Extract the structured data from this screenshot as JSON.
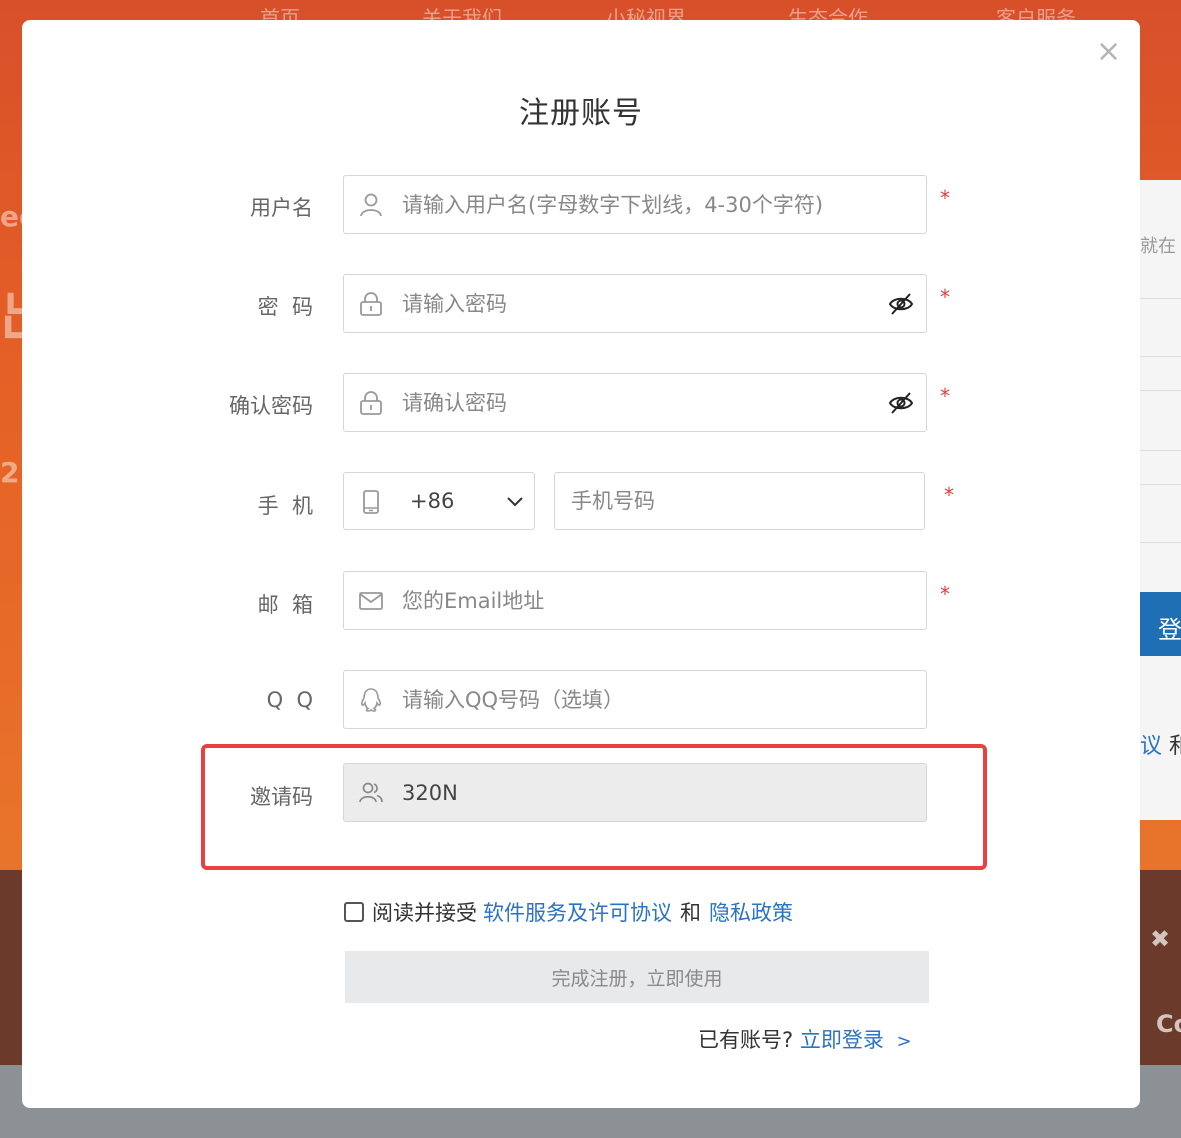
{
  "background": {
    "nav": [
      "首页",
      "关于我们",
      "小秘视界",
      "生态合作",
      "客户服务"
    ],
    "side_fragments": [
      "ee",
      "出",
      "2"
    ],
    "panel_text": "就在",
    "panel_button": "登",
    "panel_link_a": "议",
    "panel_link_b": "和",
    "dark_fragment": "Co"
  },
  "modal": {
    "close_glyph": "×",
    "title": "注册账号",
    "fields": {
      "username": {
        "label": "用户名",
        "placeholder": "请输入用户名(字母数字下划线，4-30个字符)",
        "required": "*"
      },
      "password": {
        "label": "密  码",
        "placeholder": "请输入密码",
        "required": "*"
      },
      "confirm": {
        "label": "确认密码",
        "placeholder": "请确认密码",
        "required": "*"
      },
      "phone": {
        "label": "手  机",
        "country_code": "+86",
        "placeholder": "手机号码",
        "required": "*"
      },
      "email": {
        "label": "邮  箱",
        "placeholder": "您的Email地址",
        "required": "*"
      },
      "qq": {
        "label": "Q  Q",
        "placeholder": "请输入QQ号码（选填）"
      },
      "invite": {
        "label": "邀请码",
        "value": "320N"
      }
    },
    "agreement": {
      "prefix": "阅读并接受",
      "terms_link": "软件服务及许可协议",
      "conjunction": "和",
      "privacy_link": "隐私政策"
    },
    "submit_label": "完成注册，立即使用",
    "login": {
      "prefix": "已有账号?",
      "link": "立即登录",
      "arrow": ">"
    }
  },
  "colors": {
    "accent": "#2a73c5",
    "required": "#e23b3b",
    "highlight": "#e9413f",
    "brand_orange": "#e56126"
  }
}
